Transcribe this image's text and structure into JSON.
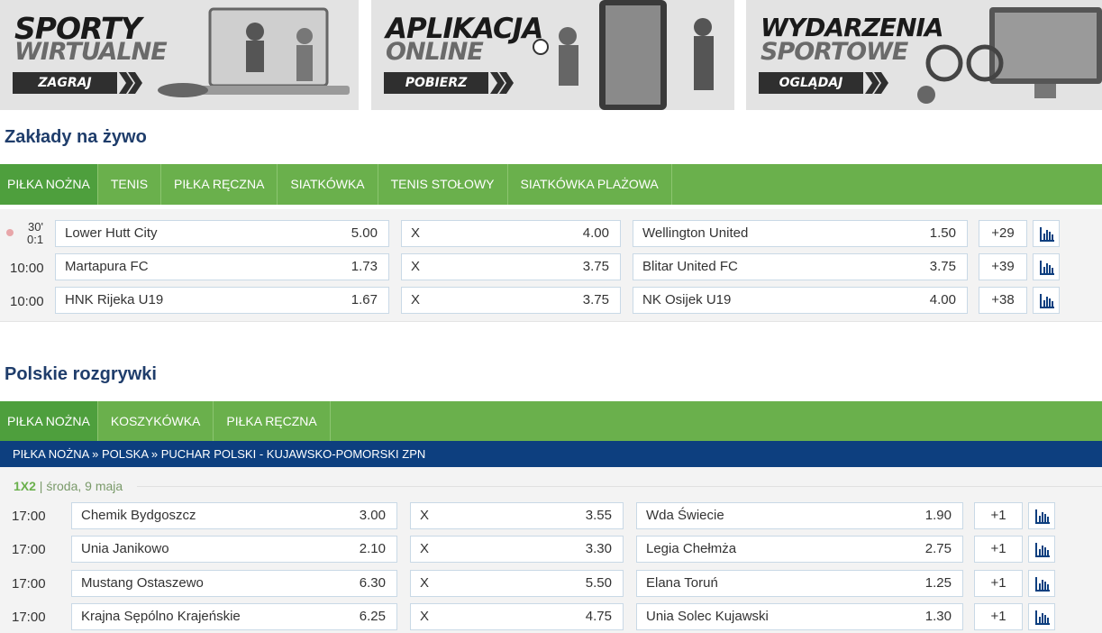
{
  "banners": [
    {
      "line1": "SPORTY",
      "line2": "WIRTUALNE",
      "button": "ZAGRAJ"
    },
    {
      "line1": "APLIKACJA",
      "line2": "ONLINE",
      "button": "POBIERZ"
    },
    {
      "line1": "WYDARZENIA",
      "line2": "SPORTOWE",
      "button": "OGLĄDAJ"
    }
  ],
  "live": {
    "title": "Zakłady na żywo",
    "tabs": [
      "PIŁKA NOŻNA",
      "TENIS",
      "PIŁKA RĘCZNA",
      "SIATKÓWKA",
      "TENIS STOŁOWY",
      "SIATKÓWKA PLAŻOWA"
    ],
    "first_minute": "30'",
    "first_score": "0:1",
    "matches": [
      {
        "time": "",
        "home": "Lower Hutt City",
        "home_odd": "5.00",
        "draw_label": "X",
        "draw_odd": "4.00",
        "away": "Wellington United",
        "away_odd": "1.50",
        "more": "+29"
      },
      {
        "time": "10:00",
        "home": "Martapura FC",
        "home_odd": "1.73",
        "draw_label": "X",
        "draw_odd": "3.75",
        "away": "Blitar United FC",
        "away_odd": "3.75",
        "more": "+39"
      },
      {
        "time": "10:00",
        "home": "HNK Rijeka U19",
        "home_odd": "1.67",
        "draw_label": "X",
        "draw_odd": "3.75",
        "away": "NK Osijek U19",
        "away_odd": "4.00",
        "more": "+38"
      }
    ]
  },
  "polish": {
    "title": "Polskie rozgrywki",
    "tabs": [
      "PIŁKA NOŻNA",
      "KOSZYKÓWKA",
      "PIŁKA RĘCZNA"
    ],
    "breadcrumb": "PIŁKA NOŻNA » POLSKA » PUCHAR POLSKI - KUJAWSKO-POMORSKI ZPN",
    "market": "1X2",
    "date": " | środa, 9 maja",
    "matches": [
      {
        "time": "17:00",
        "home": "Chemik Bydgoszcz",
        "home_odd": "3.00",
        "draw_label": "X",
        "draw_odd": "3.55",
        "away": "Wda Świecie",
        "away_odd": "1.90",
        "more": "+1"
      },
      {
        "time": "17:00",
        "home": "Unia Janikowo",
        "home_odd": "2.10",
        "draw_label": "X",
        "draw_odd": "3.30",
        "away": "Legia Chełmża",
        "away_odd": "2.75",
        "more": "+1"
      },
      {
        "time": "17:00",
        "home": "Mustang Ostaszewo",
        "home_odd": "6.30",
        "draw_label": "X",
        "draw_odd": "5.50",
        "away": "Elana Toruń",
        "away_odd": "1.25",
        "more": "+1"
      },
      {
        "time": "17:00",
        "home": "Krajna Sępólno Krajeńskie",
        "home_odd": "6.25",
        "draw_label": "X",
        "draw_odd": "4.75",
        "away": "Unia Solec Kujawski",
        "away_odd": "1.30",
        "more": "+1"
      }
    ]
  },
  "colors": {
    "green": "#6ab04c",
    "green_active": "#4e9f3d",
    "navy": "#0d3f7f",
    "title": "#1f3d6b"
  }
}
